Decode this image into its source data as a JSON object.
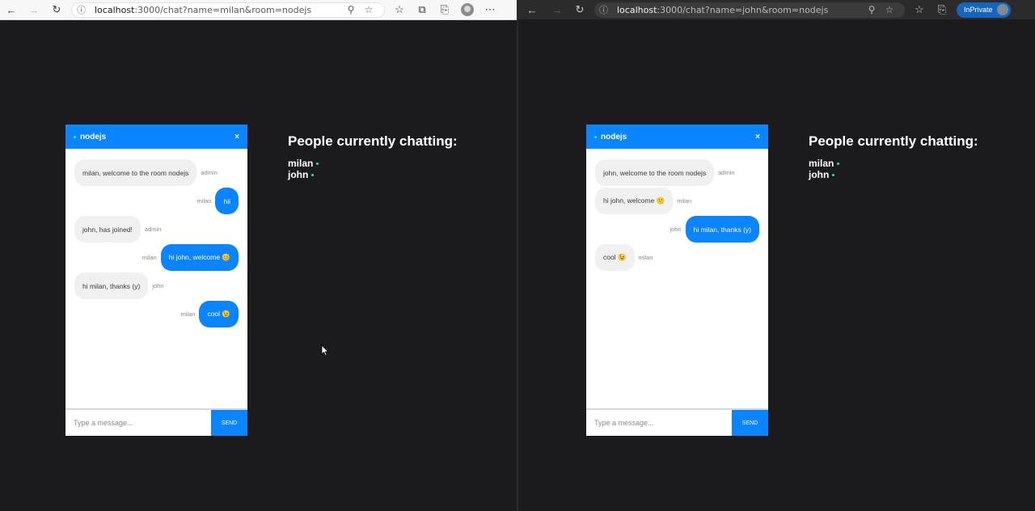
{
  "left_window": {
    "theme": "light",
    "url_host": "localhost",
    "url_path": ":3000/chat?name=milan&room=nodejs",
    "room": "nodejs",
    "close_glyph": "×",
    "messages": [
      {
        "text": "milan, welcome to the room nodejs",
        "sender": "admin",
        "mine": false
      },
      {
        "text": "hii",
        "sender": "milan",
        "mine": true
      },
      {
        "text": "john, has joined!",
        "sender": "admin",
        "mine": false
      },
      {
        "text": "hi john, welcome 😊",
        "sender": "milan",
        "mine": true
      },
      {
        "text": "hi milan, thanks (y)",
        "sender": "john",
        "mine": false
      },
      {
        "text": "cool 😉",
        "sender": "milan",
        "mine": true
      }
    ],
    "input_placeholder": "Type a message...",
    "send_label": "SEND",
    "people_heading": "People currently chatting:",
    "people": [
      "milan",
      "john"
    ]
  },
  "right_window": {
    "theme": "dark",
    "url_host": "localhost",
    "url_path": ":3000/chat?name=john&room=nodejs",
    "inprivate_label": "InPrivate",
    "room": "nodejs",
    "close_glyph": "×",
    "messages": [
      {
        "text": "john, welcome to the room nodejs",
        "sender": "admin",
        "mine": false
      },
      {
        "text": "hi john, welcome 🙂",
        "sender": "milan",
        "mine": false
      },
      {
        "text": "hi milan, thanks (y)",
        "sender": "john",
        "mine": true
      },
      {
        "text": "cool 😉",
        "sender": "milan",
        "mine": false
      }
    ],
    "input_placeholder": "Type a message...",
    "send_label": "SEND",
    "people_heading": "People currently chatting:",
    "people": [
      "milan",
      "john"
    ]
  },
  "icons": {
    "back": "back-arrow-icon",
    "forward": "forward-arrow-icon",
    "refresh": "refresh-icon",
    "info": "info-icon",
    "zoom": "zoom-icon",
    "favorite": "star-icon",
    "favorites_list": "favorites-icon",
    "collections": "collections-icon",
    "share": "share-icon",
    "more": "more-icon"
  },
  "colors": {
    "accent": "#0a84ff",
    "page_bg": "#1b1b1e",
    "online_dot": "#2ee6a0",
    "inprivate": "#1565c0"
  }
}
